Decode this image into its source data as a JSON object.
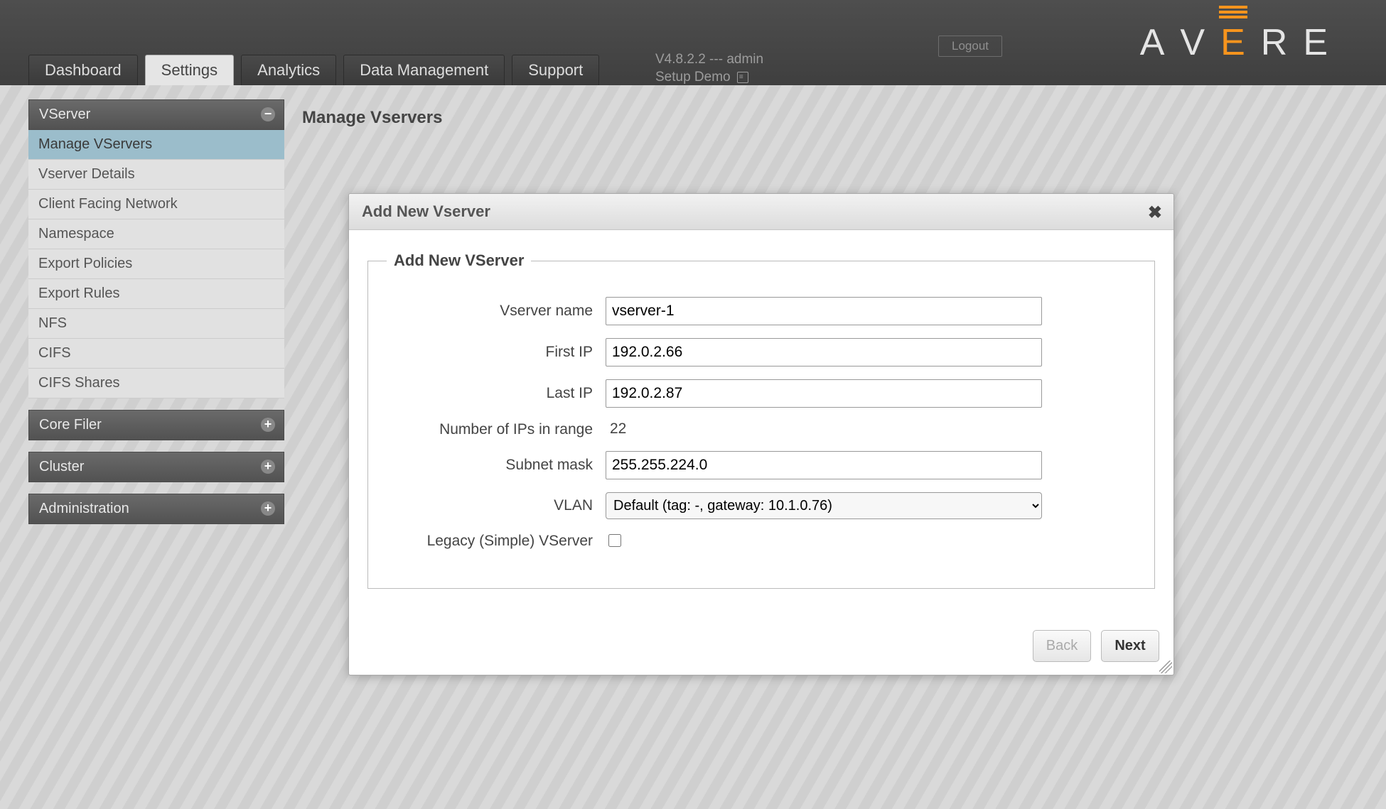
{
  "header": {
    "logout": "Logout",
    "version_line": "V4.8.2.2 --- admin",
    "demo_line": "Setup Demo",
    "logo_letters": [
      "A",
      "V",
      "E",
      "R",
      "E"
    ]
  },
  "tabs": [
    {
      "label": "Dashboard",
      "active": false
    },
    {
      "label": "Settings",
      "active": true
    },
    {
      "label": "Analytics",
      "active": false
    },
    {
      "label": "Data Management",
      "active": false
    },
    {
      "label": "Support",
      "active": false
    }
  ],
  "sidebar": {
    "sections": [
      {
        "title": "VServer",
        "expanded": true,
        "items": [
          {
            "label": "Manage VServers",
            "active": true
          },
          {
            "label": "Vserver Details"
          },
          {
            "label": "Client Facing Network"
          },
          {
            "label": "Namespace"
          },
          {
            "label": "Export Policies"
          },
          {
            "label": "Export Rules"
          },
          {
            "label": "NFS"
          },
          {
            "label": "CIFS"
          },
          {
            "label": "CIFS Shares"
          }
        ]
      },
      {
        "title": "Core Filer",
        "expanded": false
      },
      {
        "title": "Cluster",
        "expanded": false
      },
      {
        "title": "Administration",
        "expanded": false
      }
    ]
  },
  "page": {
    "title": "Manage Vservers"
  },
  "modal": {
    "header": "Add New Vserver",
    "legend": "Add New VServer",
    "labels": {
      "vserver_name": "Vserver name",
      "first_ip": "First IP",
      "last_ip": "Last IP",
      "num_ips": "Number of IPs in range",
      "subnet": "Subnet mask",
      "vlan": "VLAN",
      "legacy": "Legacy (Simple) VServer"
    },
    "values": {
      "vserver_name": "vserver-1",
      "first_ip": "192.0.2.66",
      "last_ip": "192.0.2.87",
      "num_ips": "22",
      "subnet": "255.255.224.0",
      "vlan_selected": "Default (tag: -, gateway: 10.1.0.76)",
      "legacy_checked": false
    },
    "buttons": {
      "back": "Back",
      "next": "Next"
    }
  }
}
